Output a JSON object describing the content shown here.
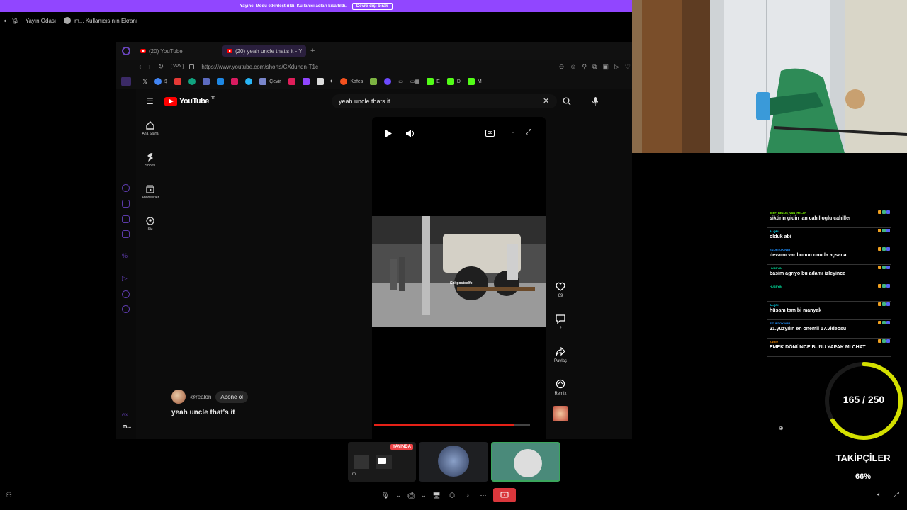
{
  "banner": {
    "text": "Yayıncı Modu etkinleştirildi. Kullanıcı adları kısaltıldı.",
    "button": "Devre dışı bırak"
  },
  "discord_top": {
    "channel": "| Yayın Odası",
    "screen": "m... Kullanıcısının Ekranı"
  },
  "browser": {
    "tabs": [
      {
        "label": "(20) YouTube"
      },
      {
        "label": "(20) yeah uncle that's it - Y"
      }
    ],
    "add_tab": "+",
    "vpn": "VPN",
    "url": "https://www.youtube.com/shorts/CXduhqn-T1c",
    "bookmarks": [
      "Çevir",
      "Kafes",
      "E",
      "D",
      "M"
    ],
    "bookmark_colors": [
      "#4285f4",
      "#e53935",
      "#43a047",
      "#fbc02d",
      "#8e24aa",
      "#00acc1",
      "#f4511e",
      "#3949ab",
      "#7cb342",
      "#d81b60"
    ]
  },
  "youtube": {
    "logo": "YouTube",
    "logo_sup": "TR",
    "search_value": "yeah uncle thats it",
    "nav": [
      {
        "label": "Ana Sayfa",
        "icon": "home-icon"
      },
      {
        "label": "Shorts",
        "icon": "shorts-icon"
      },
      {
        "label": "Abonelikler",
        "icon": "subscriptions-icon"
      },
      {
        "label": "Siz",
        "icon": "you-icon"
      }
    ],
    "video_watermark": "Shitpostselfc",
    "actions": [
      {
        "label": "69",
        "icon": "like-icon"
      },
      {
        "label": "2",
        "icon": "comment-icon"
      },
      {
        "label": "Paylaş",
        "icon": "share-icon"
      },
      {
        "label": "Remix",
        "icon": "remix-icon"
      }
    ],
    "channel": "@realon",
    "subscribe": "Abone ol",
    "title": "yeah uncle that's it",
    "progress": 0.9
  },
  "chat": [
    {
      "user": "JEFF_BEZOS_VAN_HELAP",
      "text": "siktirin gidin lan cahil oglu cahiller",
      "color": "#7fff00"
    },
    {
      "user": "ALQRI",
      "text": "olduk abi",
      "color": "#00e5ff"
    },
    {
      "user": "ZIZURTOKIN3R",
      "text": "devamı var bunun onuda açsana",
      "color": "#1e90ff"
    },
    {
      "user": "HUSEYIN",
      "text": "basim agrıyo bu adamı izleyince",
      "color": "#00e5a0"
    },
    {
      "user": "HUSEYIN",
      "text": "",
      "color": "#00e5a0"
    },
    {
      "user": "ALQRI",
      "text": "hüsam tam bi manyak",
      "color": "#00e5ff"
    },
    {
      "user": "ZIZURTOKIN3R",
      "text": "21.yüzyılın en önemli 17.videosu",
      "color": "#1e90ff"
    },
    {
      "user": "ZAGIV",
      "text": "EMEK DÖNÜNCE BUNU YAPAK MI CHAT",
      "color": "#ff8c00"
    }
  ],
  "followers": {
    "count_text": "165 / 250",
    "current": 165,
    "goal": 250,
    "label": "TAKİPÇİLER",
    "percent_text": "66%",
    "color": "#d4e000"
  },
  "discord_bottom": {
    "live_badge": "YAYINDA",
    "controls": [
      "mic-icon",
      "chevron-down-icon",
      "camera-icon",
      "chevron-down-icon",
      "screen-share-icon",
      "activities-icon",
      "soundboard-icon",
      "more-icon"
    ],
    "small_label": "m..."
  }
}
